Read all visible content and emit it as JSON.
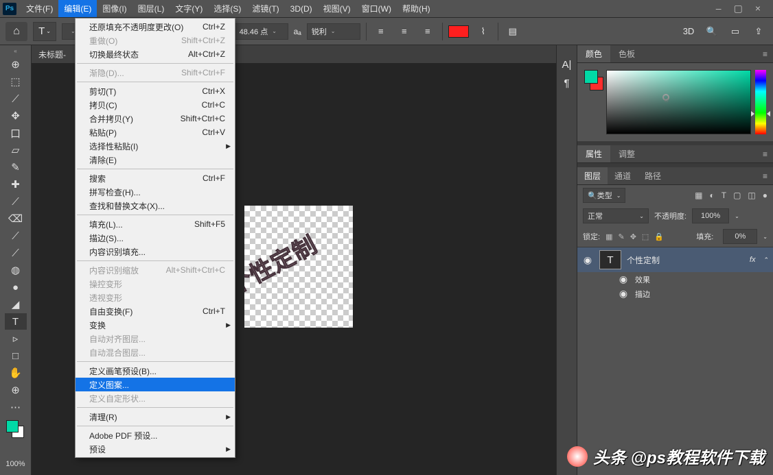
{
  "app": {
    "logo": "Ps"
  },
  "menubar": [
    "文件(F)",
    "编辑(E)",
    "图像(I)",
    "图层(L)",
    "文字(Y)",
    "选择(S)",
    "滤镜(T)",
    "3D(D)",
    "视图(V)",
    "窗口(W)",
    "帮助(H)"
  ],
  "win_controls": {
    "min": "–",
    "max": "▢",
    "close": "×"
  },
  "options": {
    "home": "⌂",
    "tool_glyph": "T",
    "t_drop": "⌄",
    "font_size": "48.46 点",
    "aa_label": "aₐ",
    "aa": "锐利",
    "three_d": "3D",
    "share": "⇪"
  },
  "doc_tab": "未标题-",
  "edit_menu": [
    {
      "type": "item",
      "label": "还原填充不透明度更改(O)",
      "shortcut": "Ctrl+Z"
    },
    {
      "type": "item",
      "label": "重做(O)",
      "shortcut": "Shift+Ctrl+Z",
      "disabled": true
    },
    {
      "type": "item",
      "label": "切换最终状态",
      "shortcut": "Alt+Ctrl+Z"
    },
    {
      "type": "sep"
    },
    {
      "type": "item",
      "label": "渐隐(D)...",
      "shortcut": "Shift+Ctrl+F",
      "disabled": true
    },
    {
      "type": "sep"
    },
    {
      "type": "item",
      "label": "剪切(T)",
      "shortcut": "Ctrl+X"
    },
    {
      "type": "item",
      "label": "拷贝(C)",
      "shortcut": "Ctrl+C"
    },
    {
      "type": "item",
      "label": "合并拷贝(Y)",
      "shortcut": "Shift+Ctrl+C"
    },
    {
      "type": "item",
      "label": "粘贴(P)",
      "shortcut": "Ctrl+V"
    },
    {
      "type": "item",
      "label": "选择性粘贴(I)",
      "sub": true
    },
    {
      "type": "item",
      "label": "清除(E)"
    },
    {
      "type": "sep"
    },
    {
      "type": "item",
      "label": "搜索",
      "shortcut": "Ctrl+F"
    },
    {
      "type": "item",
      "label": "拼写检查(H)..."
    },
    {
      "type": "item",
      "label": "查找和替换文本(X)..."
    },
    {
      "type": "sep"
    },
    {
      "type": "item",
      "label": "填充(L)...",
      "shortcut": "Shift+F5"
    },
    {
      "type": "item",
      "label": "描边(S)..."
    },
    {
      "type": "item",
      "label": "内容识别填充..."
    },
    {
      "type": "sep"
    },
    {
      "type": "item",
      "label": "内容识别缩放",
      "shortcut": "Alt+Shift+Ctrl+C",
      "disabled": true
    },
    {
      "type": "item",
      "label": "操控变形",
      "disabled": true
    },
    {
      "type": "item",
      "label": "透视变形",
      "disabled": true
    },
    {
      "type": "item",
      "label": "自由变换(F)",
      "shortcut": "Ctrl+T"
    },
    {
      "type": "item",
      "label": "变换",
      "sub": true
    },
    {
      "type": "item",
      "label": "自动对齐图层...",
      "disabled": true
    },
    {
      "type": "item",
      "label": "自动混合图层...",
      "disabled": true
    },
    {
      "type": "sep"
    },
    {
      "type": "item",
      "label": "定义画笔预设(B)..."
    },
    {
      "type": "item",
      "label": "定义图案...",
      "highlight": true
    },
    {
      "type": "item",
      "label": "定义自定形状...",
      "disabled": true
    },
    {
      "type": "sep"
    },
    {
      "type": "item",
      "label": "清理(R)",
      "sub": true
    },
    {
      "type": "sep"
    },
    {
      "type": "item",
      "label": "Adobe PDF 预设..."
    },
    {
      "type": "item",
      "label": "预设",
      "sub": true
    }
  ],
  "toolbox": {
    "tools": [
      "⊕",
      "⬚",
      "⟋",
      "✥",
      "口",
      "▱",
      "✎",
      "✚",
      "⟋",
      "⌫",
      "⟋",
      "⟋",
      "◍",
      "●",
      "◢",
      "T",
      "▹",
      "□",
      "✋",
      "⊕"
    ],
    "active_index": 15,
    "zoom": "100%"
  },
  "canvas": {
    "text": "个性定制"
  },
  "panels": {
    "strip": [
      "A|",
      "¶"
    ],
    "color": {
      "tabs": [
        "颜色",
        "色板"
      ],
      "cursor": "○"
    },
    "props": {
      "tabs": [
        "属性",
        "调整"
      ]
    },
    "layers": {
      "tabs": [
        "图层",
        "通道",
        "路径"
      ],
      "search": "类型",
      "filter_icons": [
        "▦",
        "◐",
        "T",
        "▢",
        "◫",
        "●"
      ],
      "blend": "正常",
      "opacity_label": "不透明度:",
      "opacity": "100%",
      "lock_label": "锁定:",
      "lock_icons": [
        "▦",
        "✎",
        "✥",
        "⬚",
        "🔒"
      ],
      "fill_label": "填充:",
      "fill": "0%",
      "layer": {
        "name": "个性定制",
        "fx": "fx",
        "eye": "◉",
        "thumb": "T"
      },
      "fx_items": [
        "效果",
        "描边"
      ]
    }
  },
  "watermark": "头条 @ps教程软件下载"
}
